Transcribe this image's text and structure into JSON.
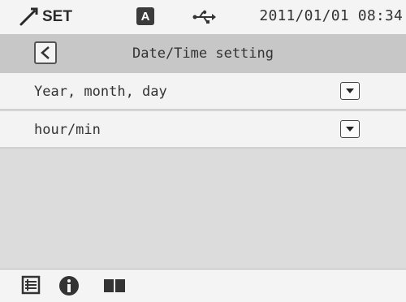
{
  "status_bar": {
    "mode_label": "SET",
    "badge": "A",
    "datetime": "2011/01/01 08:34",
    "icons": [
      "settings-wrench-icon",
      "usb-icon"
    ]
  },
  "header": {
    "title": "Date/Time setting",
    "back_icon": "chevron-left-icon"
  },
  "settings": [
    {
      "label": "Year, month, day",
      "control": "dropdown-arrow-icon"
    },
    {
      "label": "hour/min",
      "control": "dropdown-arrow-icon"
    }
  ],
  "bottom_bar": {
    "icons": [
      "list-icon",
      "info-icon",
      "book-icon"
    ]
  }
}
